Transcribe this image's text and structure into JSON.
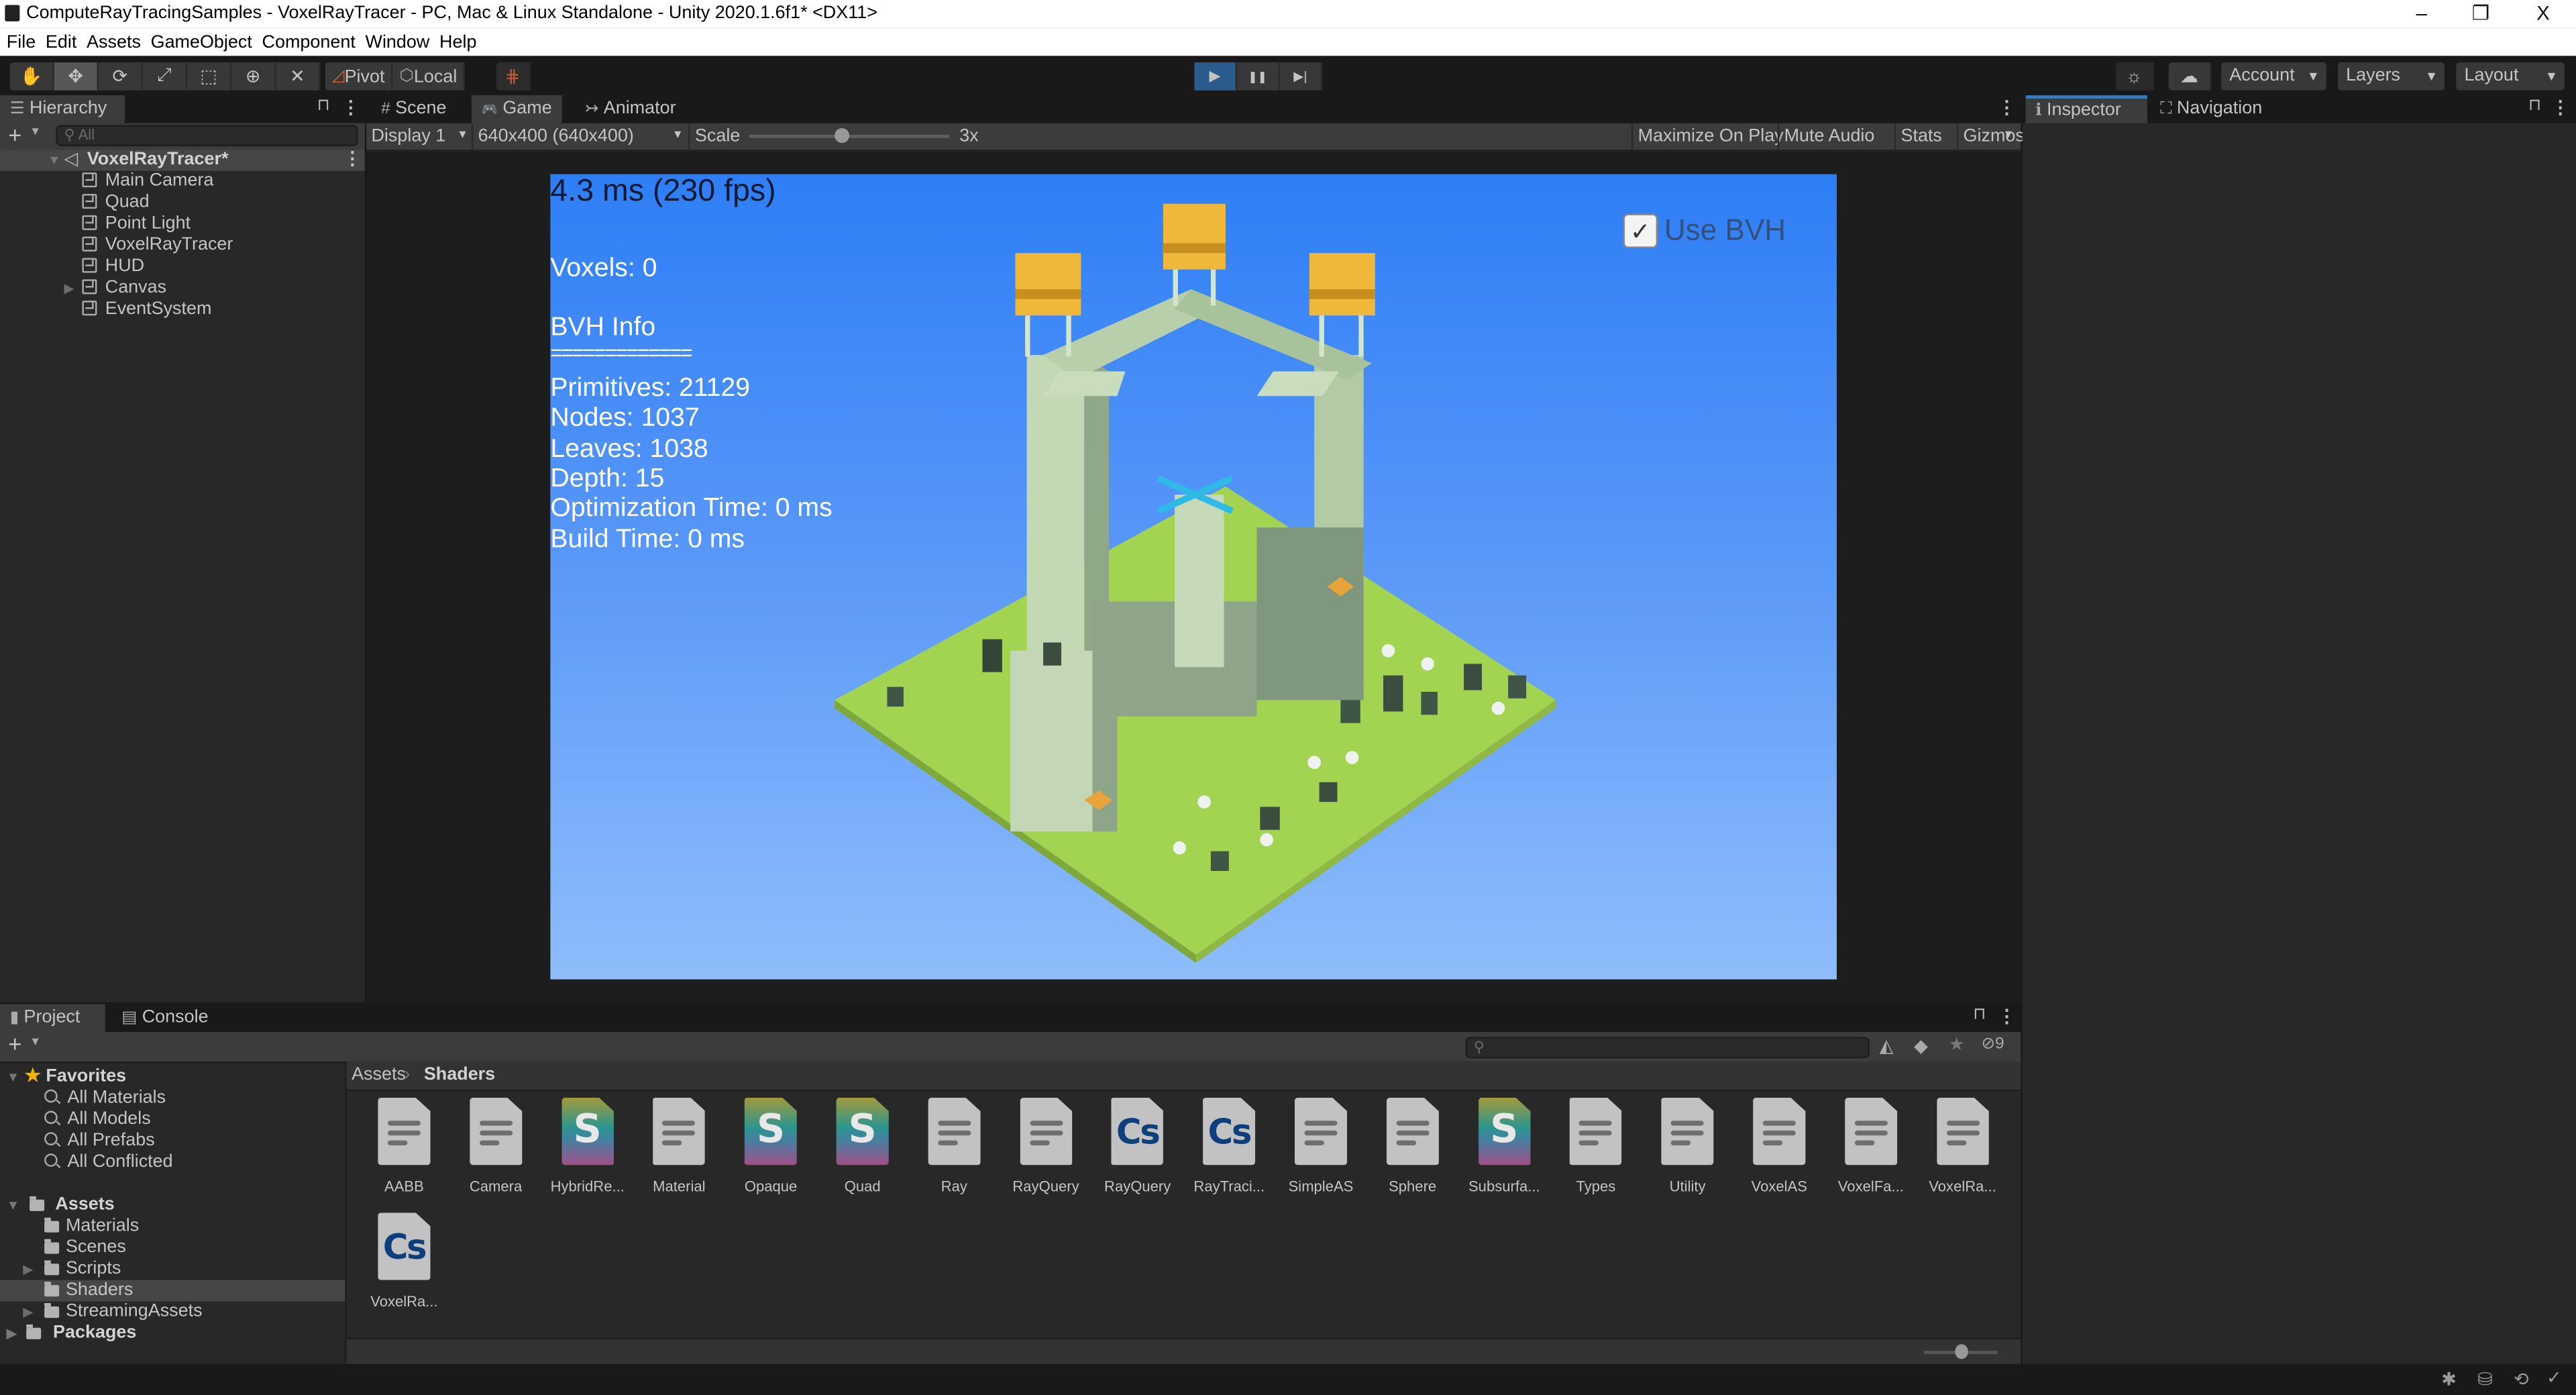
{
  "window": {
    "title": "ComputeRayTracingSamples - VoxelRayTracer - PC, Mac & Linux Standalone - Unity 2020.1.6f1* <DX11>",
    "controls": {
      "minimize": "–",
      "restore": "❐",
      "close": "X"
    }
  },
  "menu": [
    "File",
    "Edit",
    "Assets",
    "GameObject",
    "Component",
    "Window",
    "Help"
  ],
  "toolbar": {
    "tools": [
      {
        "name": "hand-tool",
        "glyph": "✋"
      },
      {
        "name": "move-tool",
        "glyph": "✥"
      },
      {
        "name": "rotate-tool",
        "glyph": "⟳"
      },
      {
        "name": "scale-tool",
        "glyph": "⤢"
      },
      {
        "name": "rect-tool",
        "glyph": "⬚"
      },
      {
        "name": "transform-tool",
        "glyph": "⊕"
      },
      {
        "name": "custom-tool",
        "glyph": "✕"
      }
    ],
    "active_tool": "move-tool",
    "pivot_label": "Pivot",
    "local_label": "Local",
    "snap_glyph": "⋕",
    "play": {
      "play": "▶",
      "pause": "❚❚",
      "step": "▶|",
      "playing": true
    },
    "collab_glyph": "☼",
    "cloud_glyph": "☁",
    "account_label": "Account",
    "layers_label": "Layers",
    "layout_label": "Layout"
  },
  "hierarchy": {
    "tab_label": "Hierarchy",
    "search_placeholder": "All",
    "scene_name": "VoxelRayTracer*",
    "items": [
      {
        "label": "Main Camera",
        "expandable": false
      },
      {
        "label": "Quad",
        "expandable": false
      },
      {
        "label": "Point Light",
        "expandable": false
      },
      {
        "label": "VoxelRayTracer",
        "expandable": false
      },
      {
        "label": "HUD",
        "expandable": false
      },
      {
        "label": "Canvas",
        "expandable": true
      },
      {
        "label": "EventSystem",
        "expandable": false
      }
    ]
  },
  "center_panel": {
    "tabs": [
      {
        "label": "Scene",
        "glyph": "#"
      },
      {
        "label": "Game",
        "glyph": "🎮",
        "selected": true
      },
      {
        "label": "Animator",
        "glyph": "↣"
      }
    ],
    "display": "Display 1",
    "resolution": "640x400 (640x400)",
    "scale_label": "Scale",
    "scale_value": "3x",
    "scale_fraction": 0.46,
    "toggles": [
      "Maximize On Play",
      "Mute Audio",
      "Stats",
      "Gizmos"
    ]
  },
  "game_view": {
    "fps_text": "4.3 ms (230 fps)",
    "voxels_text": "Voxels: 0",
    "bvh_title": "BVH Info",
    "bvh_separator": "=============",
    "stats": [
      "Primitives: 21129",
      "Nodes: 1037",
      "Leaves: 1038",
      "Depth: 15",
      "Optimization Time: 0 ms",
      "Build Time: 0 ms"
    ],
    "use_bvh_label": "Use BVH",
    "use_bvh_checked": true,
    "sky_top": "#2e7ef6",
    "sky_bottom": "#8fbdfb",
    "grass": "#a2d451",
    "stone": "#b7cfaa",
    "gold": "#f0b83a"
  },
  "inspector": {
    "tabs": [
      {
        "label": "Inspector",
        "glyph": "ℹ",
        "selected": true
      },
      {
        "label": "Navigation",
        "glyph": "⛶"
      }
    ]
  },
  "project": {
    "tabs": [
      {
        "label": "Project",
        "selected": true
      },
      {
        "label": "Console"
      }
    ],
    "hidden_count": "9",
    "favorites_label": "Favorites",
    "favorites": [
      "All Materials",
      "All Models",
      "All Prefabs",
      "All Conflicted"
    ],
    "assets_label": "Assets",
    "folders": [
      {
        "label": "Materials",
        "expandable": false
      },
      {
        "label": "Scenes",
        "expandable": false
      },
      {
        "label": "Scripts",
        "expandable": true
      },
      {
        "label": "Shaders",
        "expandable": false,
        "selected": true
      },
      {
        "label": "StreamingAssets",
        "expandable": true
      }
    ],
    "packages_label": "Packages",
    "breadcrumb": [
      "Assets",
      "Shaders"
    ],
    "files": [
      {
        "name": "AABB",
        "type": "text"
      },
      {
        "name": "Camera",
        "type": "text"
      },
      {
        "name": "HybridRe...",
        "type": "shader"
      },
      {
        "name": "Material",
        "type": "text"
      },
      {
        "name": "Opaque",
        "type": "shader"
      },
      {
        "name": "Quad",
        "type": "shader"
      },
      {
        "name": "Ray",
        "type": "text"
      },
      {
        "name": "RayQuery",
        "type": "text"
      },
      {
        "name": "RayQuery",
        "type": "cs"
      },
      {
        "name": "RayTraci...",
        "type": "cs"
      },
      {
        "name": "SimpleAS",
        "type": "text"
      },
      {
        "name": "Sphere",
        "type": "text"
      },
      {
        "name": "Subsurfa...",
        "type": "shader"
      },
      {
        "name": "Types",
        "type": "text"
      },
      {
        "name": "Utility",
        "type": "text"
      },
      {
        "name": "VoxelAS",
        "type": "text"
      },
      {
        "name": "VoxelFa...",
        "type": "text"
      },
      {
        "name": "VoxelRa...",
        "type": "text"
      },
      {
        "name": "VoxelRa...",
        "type": "cs"
      }
    ],
    "icon_size_fraction": 0.5
  }
}
